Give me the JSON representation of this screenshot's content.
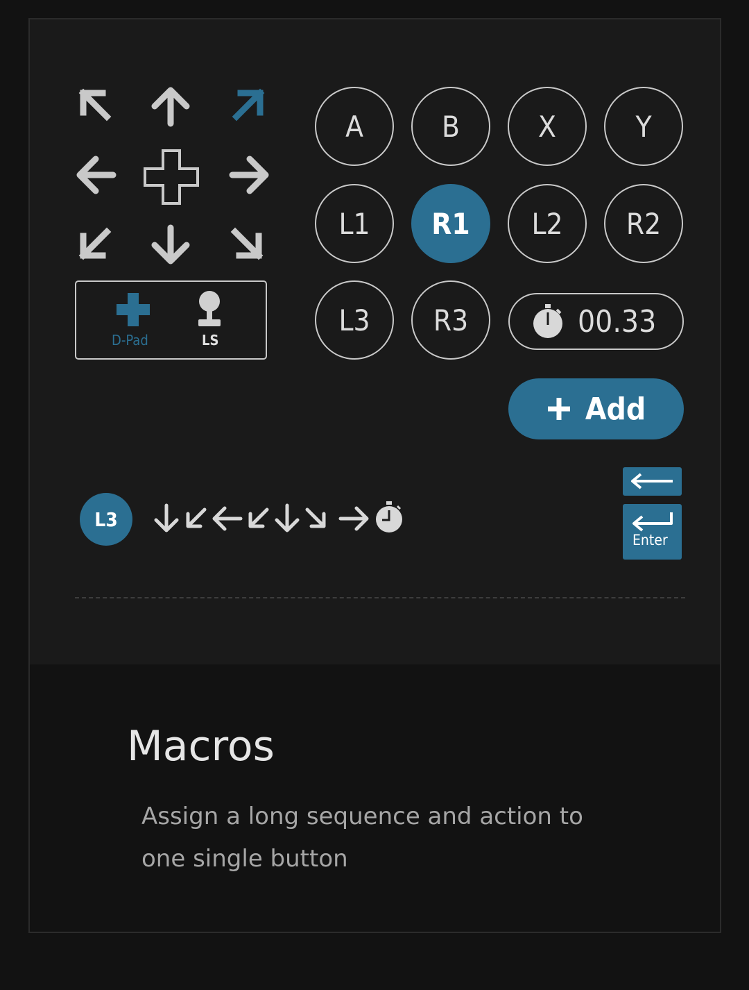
{
  "colors": {
    "accent": "#2b6f92",
    "icon_grey": "#c9c9c9",
    "panel": "#1a1a1a",
    "background": "#121212"
  },
  "dpad": {
    "items": [
      {
        "name": "arrow-up-left-icon"
      },
      {
        "name": "arrow-up-icon"
      },
      {
        "name": "arrow-up-right-icon",
        "selected": true
      },
      {
        "name": "arrow-left-icon"
      },
      {
        "name": "dpad-center-icon"
      },
      {
        "name": "arrow-right-icon"
      },
      {
        "name": "arrow-down-left-icon"
      },
      {
        "name": "arrow-down-icon"
      },
      {
        "name": "arrow-down-right-icon"
      }
    ],
    "modes": [
      {
        "icon": "dpad-plus-icon",
        "label": "D-Pad",
        "selected": true
      },
      {
        "icon": "joystick-icon",
        "label": "LS",
        "selected": false
      }
    ]
  },
  "buttons": {
    "a": "A",
    "b": "B",
    "x": "X",
    "y": "Y",
    "l1": "L1",
    "r1": "R1",
    "l2": "L2",
    "r2": "R2",
    "l3": "L3",
    "r3": "R3",
    "active": "R1"
  },
  "timer": {
    "icon": "stopwatch-icon",
    "value": "00.33"
  },
  "add_button": {
    "label": "Add",
    "icon": "plus-icon"
  },
  "sequence": {
    "trigger": "L3",
    "steps": [
      "arrow-down-icon",
      "arrow-down-left-icon",
      "arrow-left-icon",
      "arrow-down-left-icon",
      "arrow-down-icon",
      "arrow-down-right-icon",
      "arrow-right-icon",
      "stopwatch-icon"
    ]
  },
  "keys": {
    "backspace_icon": "backspace-icon",
    "enter_label": "Enter"
  },
  "feature": {
    "title": "Macros",
    "description": "Assign a long sequence and action to one single button"
  }
}
